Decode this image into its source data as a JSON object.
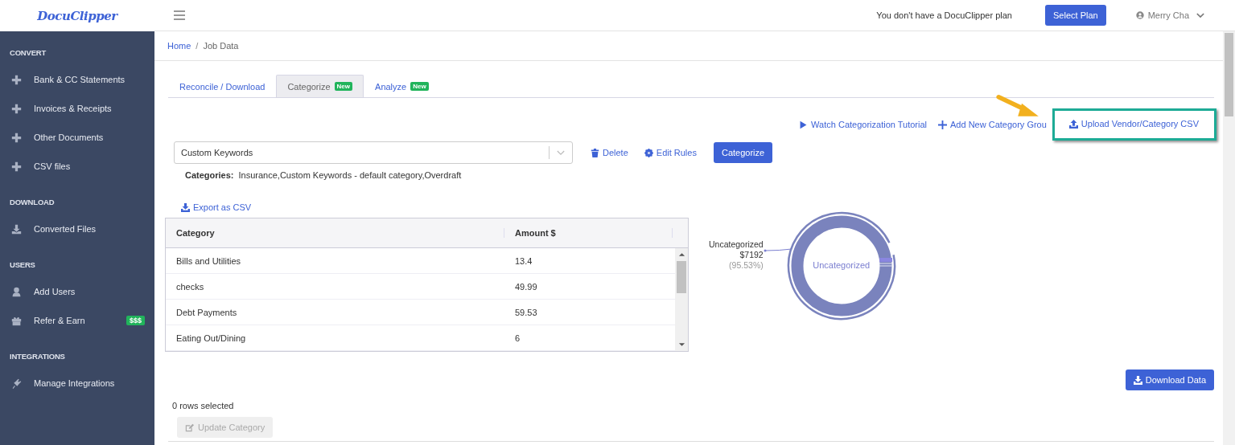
{
  "logo": "DocuClipper",
  "header": {
    "plan_notice": "You don't have a DocuClipper plan",
    "plan_button": "Select Plan",
    "user_name": "Merry Cha"
  },
  "sidebar": {
    "sections": [
      {
        "title": "CONVERT",
        "items": [
          {
            "label": "Bank & CC Statements",
            "kind": "plus"
          },
          {
            "label": "Invoices & Receipts",
            "kind": "plus"
          },
          {
            "label": "Other Documents",
            "kind": "plus"
          },
          {
            "label": "CSV files",
            "kind": "plus"
          }
        ]
      },
      {
        "title": "DOWNLOAD",
        "items": [
          {
            "label": "Converted Files",
            "kind": "download"
          }
        ]
      },
      {
        "title": "USERS",
        "items": [
          {
            "label": "Add Users",
            "kind": "user"
          },
          {
            "label": "Refer & Earn",
            "kind": "gift",
            "badge": "$$$"
          }
        ]
      },
      {
        "title": "INTEGRATIONS",
        "items": [
          {
            "label": "Manage Integrations",
            "kind": "plug"
          }
        ]
      }
    ]
  },
  "breadcrumb": [
    {
      "label": "Home",
      "link": true
    },
    {
      "label": "Job Data",
      "link": false
    }
  ],
  "breadcrumb_separator": "/",
  "tabs": [
    {
      "label": "Reconcile / Download",
      "selected": false
    },
    {
      "label": "Categorize",
      "selected": true,
      "badge": "New"
    },
    {
      "label": "Analyze",
      "selected": false,
      "badge": "New"
    }
  ],
  "actions": [
    {
      "label": "Watch Categorization Tutorial",
      "kind": "play"
    },
    {
      "label": "Add New Category Grou",
      "kind": "plus"
    },
    {
      "label": "Upload Vendor/Category CSV",
      "kind": "upload"
    }
  ],
  "rule_select": {
    "value": "Custom Keywords"
  },
  "rule_actions": [
    {
      "label": "Delete",
      "kind": "trash"
    },
    {
      "label": "Edit Rules",
      "kind": "gear"
    }
  ],
  "categorize_button": "Categorize",
  "categories": {
    "label": "Categories:",
    "value": "Insurance,Custom Keywords - default category,Overdraft"
  },
  "export_link": "Export as CSV",
  "table": {
    "columns": [
      "Category",
      "Amount $"
    ],
    "rows": [
      [
        "Bills and Utilities",
        "13.4"
      ],
      [
        "checks",
        "49.99"
      ],
      [
        "Debt Payments",
        "59.53"
      ],
      [
        "Eating Out/Dining",
        "6"
      ]
    ]
  },
  "donut": {
    "center_label": "Uncategorized",
    "callout": {
      "name": "Uncategorized",
      "amount": "$7192",
      "percent": "(95.53%)"
    }
  },
  "download_button": "Download Data",
  "selection_status": "0 rows selected",
  "update_button": {
    "label": "Update Category",
    "disabled": true
  }
}
